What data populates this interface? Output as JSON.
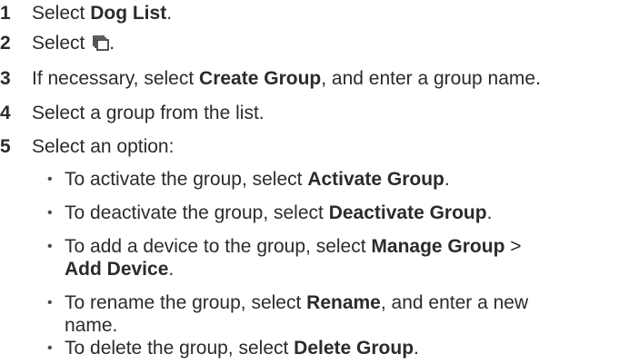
{
  "steps": [
    {
      "num": "1",
      "parts": [
        "Select ",
        "Dog List",
        "."
      ]
    },
    {
      "num": "2",
      "parts": [
        "Select ",
        "."
      ],
      "icon": "groups-icon"
    },
    {
      "num": "3",
      "parts": [
        "If necessary, select ",
        "Create Group",
        ", and enter a group name."
      ]
    },
    {
      "num": "4",
      "parts": [
        "Select a group from the list."
      ]
    },
    {
      "num": "5",
      "parts": [
        "Select an option:"
      ]
    }
  ],
  "bullet_char": "•",
  "options": [
    {
      "lines": [
        [
          "To activate the group, select ",
          "Activate Group",
          "."
        ]
      ]
    },
    {
      "lines": [
        [
          "To deactivate the group, select ",
          "Deactivate Group",
          "."
        ]
      ]
    },
    {
      "lines": [
        [
          "To add a device to the group, select ",
          "Manage Group",
          " >"
        ],
        [
          "",
          "Add Device",
          "."
        ]
      ]
    },
    {
      "lines": [
        [
          "To rename the group, select ",
          "Rename",
          ", and enter a new"
        ],
        [
          "name."
        ]
      ]
    },
    {
      "lines": [
        [
          "To delete the group, select ",
          "Delete Group",
          "."
        ]
      ]
    }
  ]
}
